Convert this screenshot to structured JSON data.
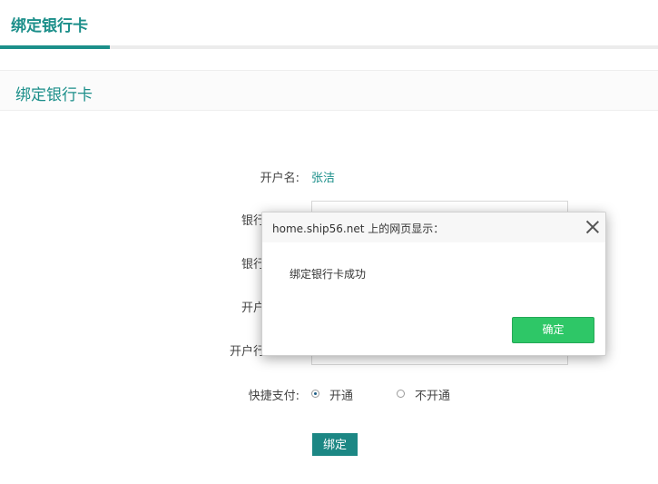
{
  "top_tab": {
    "label": "绑定银行卡"
  },
  "section": {
    "title": "绑定银行卡"
  },
  "form": {
    "account_name_label": "开户名:",
    "account_name_value": "张洁",
    "bank_label_partial": "银行",
    "bank_card_label_partial": "银行",
    "open_account_label_partial": "开户",
    "open_account_bank_label_partial": "开户行",
    "quick_pay_label": "快捷支付:",
    "quick_pay_options": [
      "开通",
      "不开通"
    ],
    "quick_pay_selected": "开通",
    "bind_button_label": "绑定"
  },
  "dialog": {
    "title": "home.ship56.net 上的网页显示：",
    "message": "绑定银行卡成功",
    "ok_label": "确定"
  },
  "colors": {
    "accent": "#1c8f8a",
    "ok_button": "#2ec767"
  }
}
